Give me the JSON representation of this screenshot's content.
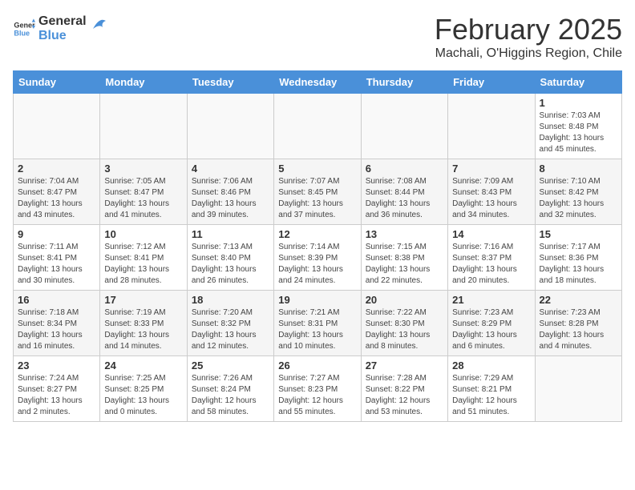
{
  "header": {
    "logo_general": "General",
    "logo_blue": "Blue",
    "title": "February 2025",
    "subtitle": "Machali, O'Higgins Region, Chile"
  },
  "weekdays": [
    "Sunday",
    "Monday",
    "Tuesday",
    "Wednesday",
    "Thursday",
    "Friday",
    "Saturday"
  ],
  "weeks": [
    [
      {
        "day": "",
        "info": ""
      },
      {
        "day": "",
        "info": ""
      },
      {
        "day": "",
        "info": ""
      },
      {
        "day": "",
        "info": ""
      },
      {
        "day": "",
        "info": ""
      },
      {
        "day": "",
        "info": ""
      },
      {
        "day": "1",
        "info": "Sunrise: 7:03 AM\nSunset: 8:48 PM\nDaylight: 13 hours and 45 minutes."
      }
    ],
    [
      {
        "day": "2",
        "info": "Sunrise: 7:04 AM\nSunset: 8:47 PM\nDaylight: 13 hours and 43 minutes."
      },
      {
        "day": "3",
        "info": "Sunrise: 7:05 AM\nSunset: 8:47 PM\nDaylight: 13 hours and 41 minutes."
      },
      {
        "day": "4",
        "info": "Sunrise: 7:06 AM\nSunset: 8:46 PM\nDaylight: 13 hours and 39 minutes."
      },
      {
        "day": "5",
        "info": "Sunrise: 7:07 AM\nSunset: 8:45 PM\nDaylight: 13 hours and 37 minutes."
      },
      {
        "day": "6",
        "info": "Sunrise: 7:08 AM\nSunset: 8:44 PM\nDaylight: 13 hours and 36 minutes."
      },
      {
        "day": "7",
        "info": "Sunrise: 7:09 AM\nSunset: 8:43 PM\nDaylight: 13 hours and 34 minutes."
      },
      {
        "day": "8",
        "info": "Sunrise: 7:10 AM\nSunset: 8:42 PM\nDaylight: 13 hours and 32 minutes."
      }
    ],
    [
      {
        "day": "9",
        "info": "Sunrise: 7:11 AM\nSunset: 8:41 PM\nDaylight: 13 hours and 30 minutes."
      },
      {
        "day": "10",
        "info": "Sunrise: 7:12 AM\nSunset: 8:41 PM\nDaylight: 13 hours and 28 minutes."
      },
      {
        "day": "11",
        "info": "Sunrise: 7:13 AM\nSunset: 8:40 PM\nDaylight: 13 hours and 26 minutes."
      },
      {
        "day": "12",
        "info": "Sunrise: 7:14 AM\nSunset: 8:39 PM\nDaylight: 13 hours and 24 minutes."
      },
      {
        "day": "13",
        "info": "Sunrise: 7:15 AM\nSunset: 8:38 PM\nDaylight: 13 hours and 22 minutes."
      },
      {
        "day": "14",
        "info": "Sunrise: 7:16 AM\nSunset: 8:37 PM\nDaylight: 13 hours and 20 minutes."
      },
      {
        "day": "15",
        "info": "Sunrise: 7:17 AM\nSunset: 8:36 PM\nDaylight: 13 hours and 18 minutes."
      }
    ],
    [
      {
        "day": "16",
        "info": "Sunrise: 7:18 AM\nSunset: 8:34 PM\nDaylight: 13 hours and 16 minutes."
      },
      {
        "day": "17",
        "info": "Sunrise: 7:19 AM\nSunset: 8:33 PM\nDaylight: 13 hours and 14 minutes."
      },
      {
        "day": "18",
        "info": "Sunrise: 7:20 AM\nSunset: 8:32 PM\nDaylight: 13 hours and 12 minutes."
      },
      {
        "day": "19",
        "info": "Sunrise: 7:21 AM\nSunset: 8:31 PM\nDaylight: 13 hours and 10 minutes."
      },
      {
        "day": "20",
        "info": "Sunrise: 7:22 AM\nSunset: 8:30 PM\nDaylight: 13 hours and 8 minutes."
      },
      {
        "day": "21",
        "info": "Sunrise: 7:23 AM\nSunset: 8:29 PM\nDaylight: 13 hours and 6 minutes."
      },
      {
        "day": "22",
        "info": "Sunrise: 7:23 AM\nSunset: 8:28 PM\nDaylight: 13 hours and 4 minutes."
      }
    ],
    [
      {
        "day": "23",
        "info": "Sunrise: 7:24 AM\nSunset: 8:27 PM\nDaylight: 13 hours and 2 minutes."
      },
      {
        "day": "24",
        "info": "Sunrise: 7:25 AM\nSunset: 8:25 PM\nDaylight: 13 hours and 0 minutes."
      },
      {
        "day": "25",
        "info": "Sunrise: 7:26 AM\nSunset: 8:24 PM\nDaylight: 12 hours and 58 minutes."
      },
      {
        "day": "26",
        "info": "Sunrise: 7:27 AM\nSunset: 8:23 PM\nDaylight: 12 hours and 55 minutes."
      },
      {
        "day": "27",
        "info": "Sunrise: 7:28 AM\nSunset: 8:22 PM\nDaylight: 12 hours and 53 minutes."
      },
      {
        "day": "28",
        "info": "Sunrise: 7:29 AM\nSunset: 8:21 PM\nDaylight: 12 hours and 51 minutes."
      },
      {
        "day": "",
        "info": ""
      }
    ]
  ]
}
